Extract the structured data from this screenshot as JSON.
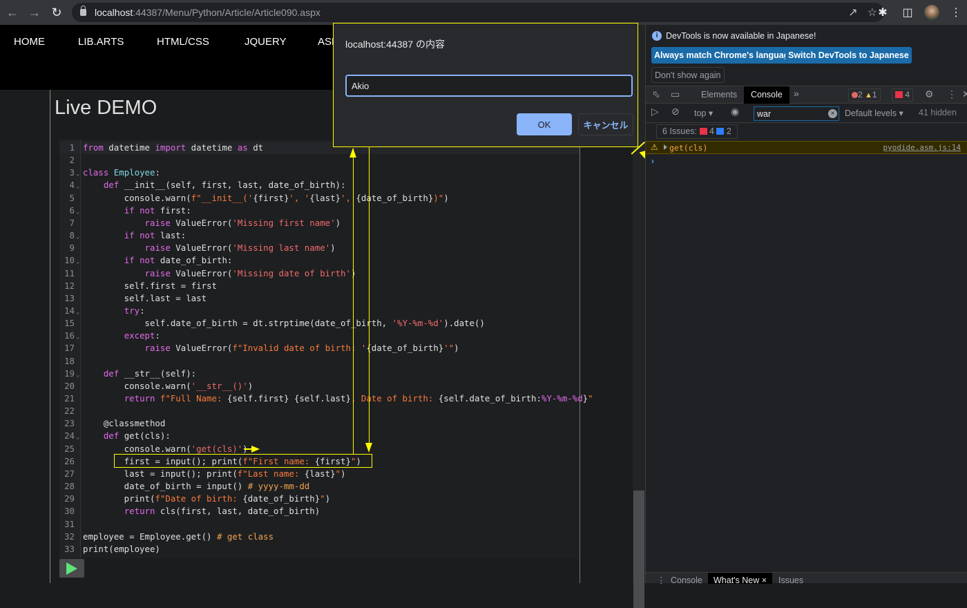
{
  "browser": {
    "url_host": "localhost",
    "url_rest": ":44387/Menu/Python/Article/Article090.aspx",
    "icons": [
      "back-icon",
      "forward-icon",
      "reload-icon",
      "lock-icon",
      "share-icon",
      "star-icon",
      "extensions-icon",
      "side-panel-icon",
      "profile-avatar",
      "menu-icon"
    ]
  },
  "site_nav": {
    "items": [
      {
        "label": "HOME"
      },
      {
        "label": "LIB.ARTS"
      },
      {
        "label": "HTML/CSS"
      },
      {
        "label": "JQUERY"
      },
      {
        "label": "ASP"
      }
    ]
  },
  "page": {
    "title": "Live DEMO"
  },
  "editor": {
    "lines": [
      {
        "n": "1",
        "fold": false,
        "html": "<span class=\"kw\">from</span> datetime <span class=\"kw\">import</span> datetime <span class=\"kw\">as</span> dt"
      },
      {
        "n": "2",
        "fold": false,
        "html": ""
      },
      {
        "n": "3",
        "fold": true,
        "html": "<span class=\"kw\">class</span> <span class=\"cls\">Employee</span>:"
      },
      {
        "n": "4",
        "fold": true,
        "html": "    <span class=\"kw\">def</span> __init__(self, first, last, date_of_birth):"
      },
      {
        "n": "5",
        "fold": false,
        "html": "        console.warn(<span class=\"fstr\">f\"__init__('</span>{first}<span class=\"fstr\">', '</span>{last}<span class=\"fstr\">', </span>{date_of_birth}<span class=\"fstr\">)\"</span>)"
      },
      {
        "n": "6",
        "fold": true,
        "html": "        <span class=\"kw\">if</span> <span class=\"kw\">not</span> first:"
      },
      {
        "n": "7",
        "fold": false,
        "html": "            <span class=\"kw\">raise</span> ValueError(<span class=\"str\">'Missing first name'</span>)"
      },
      {
        "n": "8",
        "fold": true,
        "html": "        <span class=\"kw\">if</span> <span class=\"kw\">not</span> last:"
      },
      {
        "n": "9",
        "fold": false,
        "html": "            <span class=\"kw\">raise</span> ValueError(<span class=\"str\">'Missing last name'</span>)"
      },
      {
        "n": "10",
        "fold": true,
        "html": "        <span class=\"kw\">if</span> <span class=\"kw\">not</span> date_of_birth:"
      },
      {
        "n": "11",
        "fold": false,
        "html": "            <span class=\"kw\">raise</span> ValueError(<span class=\"str\">'Missing date of birth'</span>)"
      },
      {
        "n": "12",
        "fold": false,
        "html": "        self.first = first"
      },
      {
        "n": "13",
        "fold": false,
        "html": "        self.last = last"
      },
      {
        "n": "14",
        "fold": true,
        "html": "        <span class=\"kw\">try</span>:"
      },
      {
        "n": "15",
        "fold": false,
        "html": "            self.date_of_birth = dt.strptime(date_of_birth, <span class=\"str\">'%Y-%m-%d'</span>).date()"
      },
      {
        "n": "16",
        "fold": true,
        "html": "        <span class=\"kw\">except</span>:"
      },
      {
        "n": "17",
        "fold": false,
        "html": "            <span class=\"kw\">raise</span> ValueError(<span class=\"fstr\">f\"Invalid date of birth: '</span>{date_of_birth}<span class=\"fstr\">'\"</span>)"
      },
      {
        "n": "18",
        "fold": false,
        "html": ""
      },
      {
        "n": "19",
        "fold": true,
        "html": "    <span class=\"kw\">def</span> __str__(self):"
      },
      {
        "n": "20",
        "fold": false,
        "html": "        console.warn(<span class=\"str\">'__str__()'</span>)"
      },
      {
        "n": "21",
        "fold": false,
        "html": "        <span class=\"kw\">return</span> <span class=\"fstr\">f\"Full Name: </span>{self.first} {self.last}<span class=\"fstr\">, Date of birth: </span>{self.date_of_birth:<span class=\"fmt\">%Y-%m-%d</span>}<span class=\"fstr\">\"</span>"
      },
      {
        "n": "22",
        "fold": false,
        "html": ""
      },
      {
        "n": "23",
        "fold": false,
        "html": "    @classmethod"
      },
      {
        "n": "24",
        "fold": true,
        "html": "    <span class=\"kw\">def</span> get(cls):"
      },
      {
        "n": "25",
        "fold": false,
        "html": "        console.warn(<span class=\"str\">'get(cls)'</span>)"
      },
      {
        "n": "26",
        "fold": false,
        "html": "        first = input(); print(<span class=\"fstr\">f\"First name: </span>{first}<span class=\"fstr\">\"</span>)"
      },
      {
        "n": "27",
        "fold": false,
        "html": "        last = input(); print(<span class=\"fstr\">f\"Last name: </span>{last}<span class=\"fstr\">\"</span>)"
      },
      {
        "n": "28",
        "fold": false,
        "html": "        date_of_birth = input() <span class=\"cm\"># yyyy-mm-dd</span>"
      },
      {
        "n": "29",
        "fold": false,
        "html": "        print(<span class=\"fstr\">f\"Date of birth: </span>{date_of_birth}<span class=\"fstr\">\"</span>)"
      },
      {
        "n": "30",
        "fold": false,
        "html": "        <span class=\"kw\">return</span> cls(first, last, date_of_birth)"
      },
      {
        "n": "31",
        "fold": false,
        "html": ""
      },
      {
        "n": "32",
        "fold": false,
        "html": "employee = Employee.get() <span class=\"cm\"># get class</span>"
      },
      {
        "n": "33",
        "fold": false,
        "html": "print(employee)"
      }
    ],
    "run_icon": "play-icon"
  },
  "dialog": {
    "title": "localhost:44387 の内容",
    "input_value": "Akio",
    "ok_label": "OK",
    "cancel_label": "キャンセル"
  },
  "devtools": {
    "info_text": "DevTools is now available in Japanese!",
    "btn_match": "Always match Chrome's language",
    "btn_switch": "Switch DevTools to Japanese",
    "btn_dont_show": "Don't show again",
    "tabs": [
      {
        "label": "Elements"
      },
      {
        "label": "Console"
      }
    ],
    "more_tabs": "»",
    "error_count": "2",
    "warning_count": "1",
    "issue_count": "4",
    "context": "top",
    "filter_value": "war",
    "levels": "Default levels",
    "hidden": "41 hidden",
    "issues_label": "6 Issues:",
    "issues_red": "4",
    "issues_blue": "2",
    "log": {
      "message": "get(cls)",
      "source": "pyodide.asm.js:14"
    },
    "drawer_tabs": [
      {
        "label": "Console"
      },
      {
        "label": "What's New"
      },
      {
        "label": "Issues"
      }
    ]
  },
  "colors": {
    "annotation": "#ffff00",
    "accent": "#8ab4f8",
    "devtools_button": "#1a6ba8"
  }
}
